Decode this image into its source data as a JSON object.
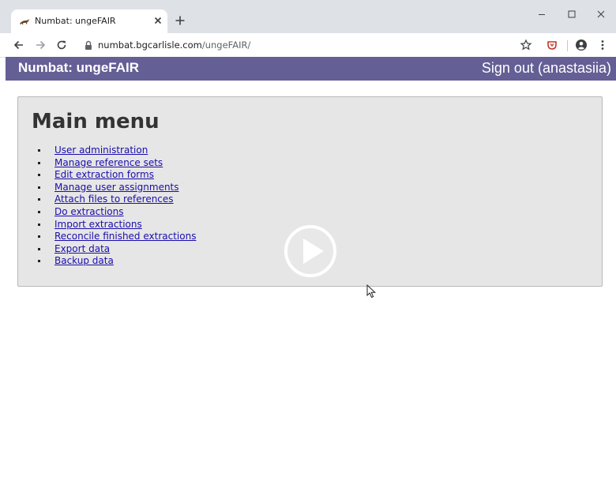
{
  "browser": {
    "tab_title": "Numbat: ungeFAIR",
    "url_domain": "numbat.bgcarlisle.com",
    "url_path": "/ungeFAIR/"
  },
  "header": {
    "site_title": "Numbat: ungeFAIR",
    "signout_label": "Sign out (anastasiia)"
  },
  "menu": {
    "title": "Main menu",
    "items": [
      {
        "label": "User administration"
      },
      {
        "label": "Manage reference sets"
      },
      {
        "label": "Edit extraction forms"
      },
      {
        "label": "Manage user assignments"
      },
      {
        "label": "Attach files to references"
      },
      {
        "label": "Do extractions"
      },
      {
        "label": "Import extractions"
      },
      {
        "label": "Reconcile finished extractions"
      },
      {
        "label": "Export data"
      },
      {
        "label": "Backup data"
      }
    ]
  },
  "colors": {
    "header_bg": "#645f95",
    "link": "#1a0dab",
    "panel_bg": "#e6e6e6"
  },
  "icons": {
    "tab_favicon": "numbat-icon",
    "overlay": "play-icon"
  }
}
